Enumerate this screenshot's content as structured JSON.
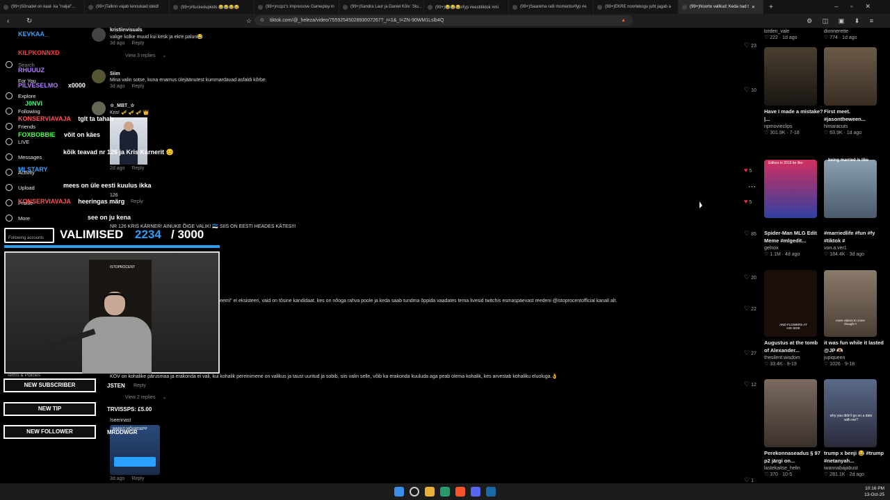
{
  "tabs": [
    {
      "label": "(99+)Sõnadel on kaal- ka \"naljal\"..."
    },
    {
      "label": "(99+)Tallinn vajab lennukaid ideid!"
    },
    {
      "label": "(99+)#fuckedupkids 😂😂😂😂"
    },
    {
      "label": "(99+)rccpz's Impressive Gameplay in"
    },
    {
      "label": "(99+)Sandra Laur ja Daniel Kõiv: Stu..."
    },
    {
      "label": "(99+)😂😂😂#fyp #eestitiktok #mi"
    },
    {
      "label": "(99+)Saarema ralli moments#fyp #e"
    },
    {
      "label": "(99+)EKRE noortekogu juht jagab a"
    },
    {
      "label": "(99+)Noorte valikud: Keda nad t"
    }
  ],
  "address": {
    "url": "tiktok.com/@_heleza/video/7559254502893007267?_r=1&_t=ZN-90WM1Lslb4Q"
  },
  "comments": [
    {
      "name": "kristiinvisuals",
      "text": "valige kolke muud kui kesk ja ekre palun😂",
      "age": "3d ago",
      "reply": "Reply",
      "likes": "23",
      "sub": "View 3 replies"
    },
    {
      "name": "Siim",
      "text": "Mina valin sotse, kuna enamus ülejäänutest kummardavad asfaldi kõrbe.",
      "age": "3d ago",
      "reply": "Reply",
      "likes": "10"
    },
    {
      "name": "☆_MBT_☆",
      "text": "Kris! 🎺 🎺 🎺 👑",
      "age": "2d ago",
      "reply": "Reply",
      "likes": "5"
    },
    {
      "name": "",
      "text": "126",
      "age": "",
      "reply": "Reply",
      "likes": "5"
    },
    {
      "name": "",
      "text": "NR 126 KRIS KÄRNER! AINUKE ÕIGE VALIK! 🇪🇪 SIIS ON EESTI HEADES KÄTES!!!",
      "age": "",
      "reply": "",
      "likes": "85"
    },
    {
      "name": "",
      "text": "",
      "age": "",
      "reply": "",
      "likes": "20"
    },
    {
      "name": "",
      "text": "eemi\" ei eksisteeri, vaid on tõsine kandidaat, kes on nõoga rahva poole ja keda saab tundma õppida vaadates tema livesid twitchis esmaspäevast reedeni @istoprocentofficial kanali alt.",
      "age": "",
      "reply": "",
      "likes": "22"
    },
    {
      "name": "",
      "text": "",
      "age": "",
      "reply": "",
      "likes": "27"
    },
    {
      "name": "",
      "text": "KOV on kohalike pärusmaa ja erakonda ei vali, kui kohalik pereinimene on valikus ja taust uuritud ja sobib, siis valin selle, võib ka erakonda kuuluda aga peab olema kohalik, kes arvestab kohaliku eluoluga.👌",
      "age": "",
      "reply": "Reply",
      "likes": "12",
      "sub": "View 2 replies"
    },
    {
      "name": "",
      "text": "Iseennast",
      "age": "3d ago",
      "reply": "Reply",
      "likes": "1"
    }
  ],
  "chat": [
    {
      "user": "KEVKAA_",
      "color": "#3aa0ff",
      "msg": ""
    },
    {
      "user": "KILPKONNXD",
      "color": "#ff3b3b",
      "msg": ""
    },
    {
      "user": "RHUUUZ",
      "color": "#b07cff",
      "msg": ""
    },
    {
      "user": "PILVESELMO",
      "color": "#b07cff",
      "msg": "x0000"
    },
    {
      "user": "J0NVI",
      "color": "#3aff7a",
      "msg": ""
    },
    {
      "user": "KONSERVIAVAJA",
      "color": "#ff5555",
      "msg": "tglt ta tahab"
    },
    {
      "user": "FOXBOBBIE",
      "color": "#4dff4d",
      "msg": "võit on käes"
    },
    {
      "user": "",
      "color": "#3aa0ff",
      "msg": "kõik teavad nr 126 ja Kris Kärnerit 😊"
    },
    {
      "user": "MLSTARY",
      "color": "#3aa0ff",
      "msg": ""
    },
    {
      "user": "",
      "color": "#b07cff",
      "msg": "mees on üle eesti kuulus ikka"
    },
    {
      "user": "KONSERVIAVAJA",
      "color": "#ff5555",
      "msg": "heeringas märg"
    },
    {
      "user": "",
      "color": "#3aa0ff",
      "msg": "see on ju kena"
    }
  ],
  "nav": {
    "search": "Search",
    "for_you": "For You",
    "explore": "Explore",
    "following": "Following",
    "friends": "Friends",
    "live": "LIVE",
    "messages": "Messages",
    "activity": "Activity",
    "upload": "Upload",
    "profile": "Profile",
    "more": "More",
    "terms": "Terms & Policies",
    "following_accounts": "Following accounts"
  },
  "overlay": {
    "counter_label": "VALIMISED",
    "counter_value": "2234",
    "counter_total": "/ 3000",
    "new_subscriber": "NEW SUBSCRIBER",
    "new_tip": "NEW TIP",
    "new_follower": "NEW FOLLOWER",
    "sub_name": "JSTEN",
    "tip_name": "TRVISSPS: £5.00",
    "follower_name": "MRDDWGR",
    "badge": "ISTOPROCENT",
    "poster_user": "MARKO MÕURISEPP"
  },
  "videos": [
    {
      "title": "",
      "user": "lorden_vale",
      "stats": "222 · 1d ago",
      "color": "#2a2a2a"
    },
    {
      "title": "",
      "user": "dionnerette",
      "stats": "774 · 1d ago",
      "color": "#2a2a2a"
    },
    {
      "title": "Have I made a mistake? |...",
      "user": "npmovieclips",
      "stats": "301.9K · 7-18",
      "color": "#3a3228"
    },
    {
      "title": "First meet. #jasontheween...",
      "user": "himaracuts",
      "stats": "63.9K · 1d ago",
      "color": "#5a4a3a"
    },
    {
      "title": "Spider-Man MLG Edit Meme #mlgedit...",
      "user": "gelnox",
      "stats": "1.1M · 4d ago",
      "color": "#b02050",
      "caption": "Editors in 2016 be like:"
    },
    {
      "title": "#marriedlife #fun #fy #tiktok #",
      "user": "von.a.ver1",
      "stats": "184.4K · 3d ago",
      "color": "#6a8aa0",
      "caption": "being married is like"
    },
    {
      "title": "Augustus at the tomb of Alexander...",
      "user": "thesilent.wisdom",
      "stats": "33.4K · 9-19",
      "color": "#2a1a14",
      "caption": "AND FLOWERS AT HIS SIDE"
    },
    {
      "title": "it was fun while it lasted @JP 🫶🏻",
      "user": "jupiqueen",
      "stats": "1026 · 9-18",
      "color": "#7a6a5a",
      "caption": "more videos to come though !!"
    },
    {
      "title": "Perekonnaseadus § 97 p2 järgi on...",
      "user": "lastekaitse_helin",
      "stats": "370 · 10-5",
      "color": "#6a5a50"
    },
    {
      "title": "trump x benji 😂 #trump #netanyah...",
      "user": "iwannabajabust",
      "stats": "281.1K · 2d ago",
      "color": "#3a4a6a",
      "caption": "why you didn't go on a date with me?"
    }
  ],
  "taskbar": {
    "time": "10:16 PM",
    "date": "13-Oct-25"
  }
}
